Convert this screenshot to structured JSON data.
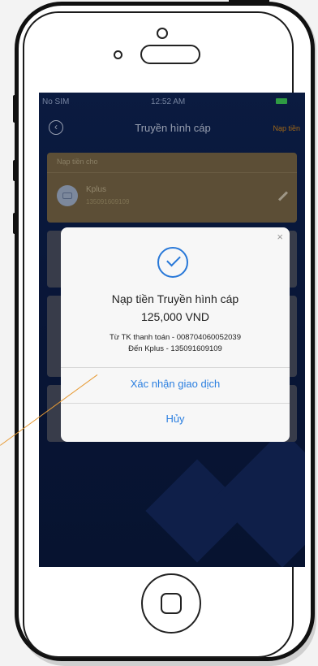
{
  "statusbar": {
    "carrier": "No SIM",
    "time": "12:52 AM"
  },
  "navbar": {
    "title": "Truyền hình cáp",
    "action": "Nạp tiền"
  },
  "card": {
    "header": "Nạp tiền cho",
    "provider": "Kplus",
    "account_number": "135091609109"
  },
  "dialog": {
    "close": "×",
    "title": "Nạp tiền Truyền hình cáp",
    "amount": "125,000 VND",
    "from_line": "Từ TK thanh toán - 008704060052039",
    "to_line": "Đến Kplus - 135091609109",
    "confirm_label": "Xác nhận giao dịch",
    "cancel_label": "Hủy"
  },
  "colors": {
    "accent": "#2b7fe0",
    "navy": "#0e1f4d",
    "gold": "#7b6848",
    "pointer": "#e79a34"
  }
}
